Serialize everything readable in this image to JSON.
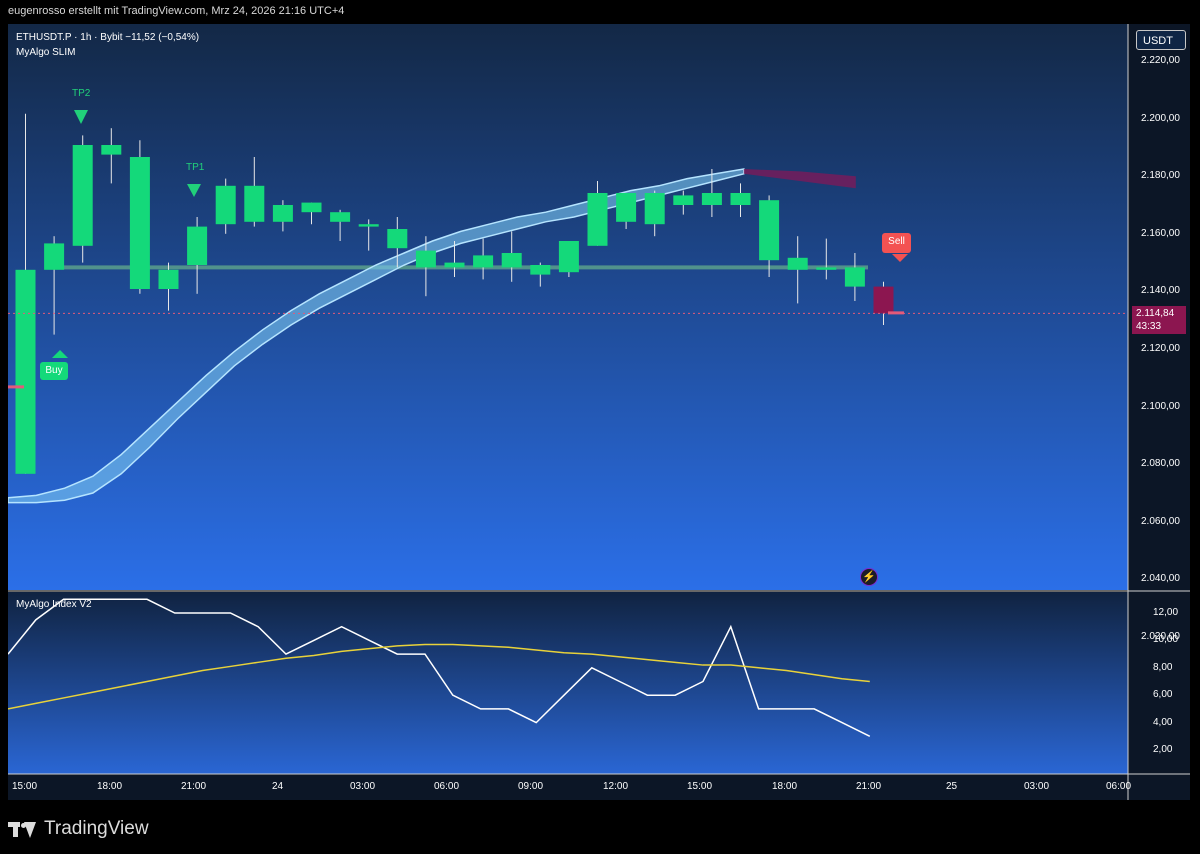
{
  "header": {
    "attribution": "eugenrosso erstellt mit TradingView.com, Mrz 24, 2026 21:16 UTC+4"
  },
  "legend": {
    "symbol_line": "ETHUSDT.P · 1h · Bybit  −11,52 (−0,54%)",
    "indicator": "MyAlgo SLIM",
    "sub_indicator": "MyAlgo Index V2"
  },
  "currency_button": "USDT",
  "last_price": {
    "price": "2.114,84",
    "countdown": "43:33",
    "value": 2114.84
  },
  "y_axis_main": [
    "2.220,00",
    "2.200,00",
    "2.180,00",
    "2.160,00",
    "2.140,00",
    "2.120,00",
    "2.100,00",
    "2.080,00",
    "2.060,00",
    "2.040,00",
    "2.020,00"
  ],
  "y_axis_sub": [
    "12,00",
    "10,00",
    "8,00",
    "6,00",
    "4,00",
    "2,00"
  ],
  "x_axis": [
    "15:00",
    "18:00",
    "21:00",
    "24",
    "03:00",
    "06:00",
    "09:00",
    "12:00",
    "15:00",
    "18:00",
    "21:00",
    "25",
    "03:00",
    "06:00"
  ],
  "signals": {
    "buy": "Buy",
    "sell": "Sell",
    "tp1": "TP1",
    "tp2": "TP2"
  },
  "brand": "TradingView",
  "colors": {
    "up": "#14d97a",
    "down": "#8c1650",
    "band": "#7cc6f0",
    "yellow": "#e8d23a",
    "white": "#ffffff",
    "bg_top": "#132846",
    "bg_bottom": "#2b6fe8"
  },
  "chart_data": [
    {
      "type": "candlestick",
      "ylim": [
        2000,
        2230
      ],
      "candles": [
        {
          "o": 2048,
          "h": 2198,
          "l": 2048,
          "c": 2133
        },
        {
          "o": 2133,
          "h": 2147,
          "l": 2106,
          "c": 2144
        },
        {
          "o": 2143,
          "h": 2189,
          "l": 2136,
          "c": 2185
        },
        {
          "o": 2185,
          "h": 2192,
          "l": 2169,
          "c": 2181
        },
        {
          "o": 2180,
          "h": 2187,
          "l": 2123,
          "c": 2125
        },
        {
          "o": 2125,
          "h": 2136,
          "l": 2116,
          "c": 2133
        },
        {
          "o": 2135,
          "h": 2155,
          "l": 2123,
          "c": 2151
        },
        {
          "o": 2152,
          "h": 2171,
          "l": 2148,
          "c": 2168
        },
        {
          "o": 2168,
          "h": 2180,
          "l": 2151,
          "c": 2153
        },
        {
          "o": 2153,
          "h": 2162,
          "l": 2149,
          "c": 2160
        },
        {
          "o": 2157,
          "h": 2161,
          "l": 2152,
          "c": 2161
        },
        {
          "o": 2157,
          "h": 2158,
          "l": 2145,
          "c": 2153
        },
        {
          "o": 2152,
          "h": 2154,
          "l": 2141,
          "c": 2151
        },
        {
          "o": 2150,
          "h": 2155,
          "l": 2134,
          "c": 2142
        },
        {
          "o": 2141,
          "h": 2147,
          "l": 2122,
          "c": 2134
        },
        {
          "o": 2134,
          "h": 2145,
          "l": 2130,
          "c": 2136
        },
        {
          "o": 2134,
          "h": 2146,
          "l": 2129,
          "c": 2139
        },
        {
          "o": 2134,
          "h": 2149,
          "l": 2128,
          "c": 2140
        },
        {
          "o": 2131,
          "h": 2136,
          "l": 2126,
          "c": 2135
        },
        {
          "o": 2132,
          "h": 2145,
          "l": 2130,
          "c": 2145
        },
        {
          "o": 2143,
          "h": 2170,
          "l": 2143,
          "c": 2165
        },
        {
          "o": 2153,
          "h": 2165,
          "l": 2150,
          "c": 2165
        },
        {
          "o": 2152,
          "h": 2166,
          "l": 2147,
          "c": 2165
        },
        {
          "o": 2160,
          "h": 2166,
          "l": 2156,
          "c": 2164
        },
        {
          "o": 2160,
          "h": 2175,
          "l": 2155,
          "c": 2165
        },
        {
          "o": 2160,
          "h": 2169,
          "l": 2155,
          "c": 2165
        },
        {
          "o": 2162,
          "h": 2164,
          "l": 2130,
          "c": 2137
        },
        {
          "o": 2138,
          "h": 2147,
          "l": 2119,
          "c": 2133
        },
        {
          "o": 2133,
          "h": 2146,
          "l": 2129,
          "c": 2134
        },
        {
          "o": 2134,
          "h": 2140,
          "l": 2120,
          "c": 2126
        },
        {
          "o": 2126,
          "h": 2128,
          "l": 2110,
          "c": 2114.84
        }
      ],
      "band_upper": [
        2038,
        2039,
        2042,
        2047,
        2056,
        2067,
        2078,
        2089,
        2099,
        2108,
        2116,
        2123,
        2129,
        2135,
        2140,
        2145,
        2149,
        2152,
        2155,
        2157,
        2160,
        2163,
        2166,
        2168,
        2171,
        2173,
        2175
      ],
      "band_lower": [
        2036,
        2036,
        2037,
        2040,
        2048,
        2059,
        2071,
        2082,
        2093,
        2102,
        2110,
        2117,
        2123,
        2129,
        2135,
        2140,
        2144,
        2147,
        2150,
        2153,
        2155,
        2158,
        2161,
        2164,
        2167,
        2170,
        2173
      ],
      "band_upper_down": [
        2175,
        2174,
        2172
      ],
      "band_lower_down": [
        2173,
        2170,
        2167
      ],
      "horizontal_level": 2134
    },
    {
      "type": "line",
      "ylim": [
        0,
        13.5
      ],
      "series": [
        {
          "values": [
            9,
            11.5,
            13,
            13,
            13,
            13,
            12,
            12,
            12,
            11,
            9,
            10,
            11,
            10,
            9,
            9,
            6,
            5,
            5,
            4,
            6,
            8,
            7,
            6,
            6,
            7,
            11,
            5,
            5,
            5,
            4,
            3
          ]
        },
        {
          "values": [
            5,
            5.4,
            5.8,
            6.2,
            6.6,
            7,
            7.4,
            7.8,
            8.1,
            8.4,
            8.7,
            8.9,
            9.2,
            9.4,
            9.6,
            9.7,
            9.7,
            9.6,
            9.5,
            9.3,
            9.1,
            9,
            8.8,
            8.6,
            8.4,
            8.2,
            8.2,
            8,
            7.8,
            7.5,
            7.2,
            7
          ]
        }
      ]
    }
  ]
}
